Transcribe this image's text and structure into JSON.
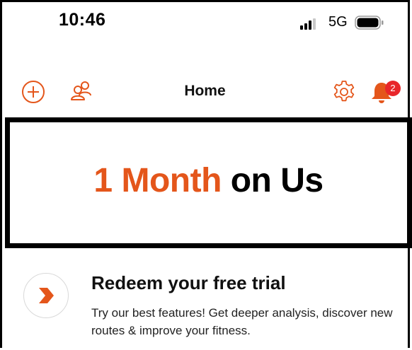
{
  "status_bar": {
    "time": "10:46",
    "network": "5G"
  },
  "nav": {
    "title": "Home",
    "notification_count": "2",
    "accent_color": "#e4561b"
  },
  "hero": {
    "accent_text": "1 Month",
    "rest_text": "on Us"
  },
  "promo": {
    "title": "Redeem your free trial",
    "description": "Try our best features! Get deeper analysis, discover new routes & improve your fitness."
  },
  "icons": [
    "add-circle-icon",
    "friends-icon",
    "gear-icon",
    "bell-icon",
    "chevron-right-icon",
    "signal-icon",
    "battery-icon"
  ]
}
